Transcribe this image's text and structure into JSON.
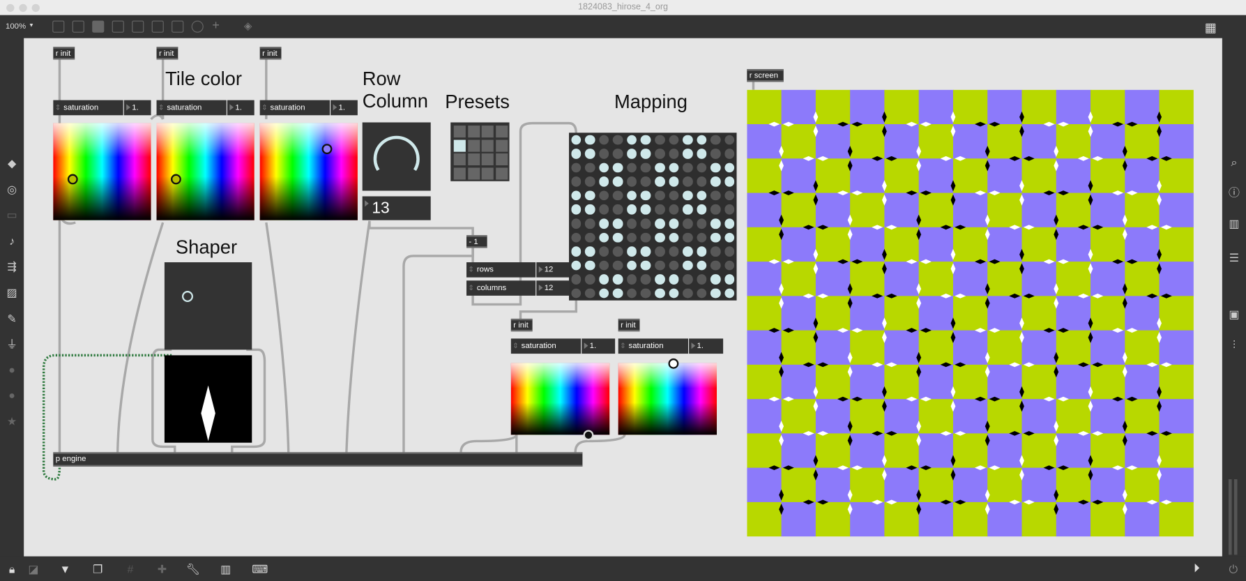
{
  "window": {
    "title": "1824083_hirose_4_org",
    "zoom": "100%"
  },
  "patch": {
    "r_init": "r init",
    "r_screen": "r screen",
    "p_engine": "p engine",
    "minus_one": "- 1",
    "headings": {
      "tile_color": "Tile color",
      "row": "Row",
      "column": "Column",
      "presets": "Presets",
      "mapping": "Mapping",
      "shaper": "Shaper"
    },
    "tile_color_menus": [
      {
        "label": "saturation",
        "value": "1."
      },
      {
        "label": "saturation",
        "value": "1."
      },
      {
        "label": "saturation",
        "value": "1."
      }
    ],
    "lower_menus": [
      {
        "label": "saturation",
        "value": "1."
      },
      {
        "label": "saturation",
        "value": "1."
      }
    ],
    "dial_value": "13",
    "rows": {
      "label": "rows",
      "value": "12"
    },
    "columns": {
      "label": "columns",
      "value": "12"
    },
    "presets": {
      "rows": 4,
      "cols": 4,
      "selected": [
        1,
        0
      ]
    },
    "mapping": [
      [
        1,
        1,
        0,
        0,
        1,
        1,
        0,
        0,
        1,
        1,
        0,
        0
      ],
      [
        1,
        1,
        0,
        0,
        1,
        1,
        0,
        0,
        1,
        1,
        0,
        0
      ],
      [
        0,
        0,
        1,
        1,
        0,
        0,
        1,
        1,
        0,
        0,
        1,
        1
      ],
      [
        0,
        0,
        1,
        1,
        0,
        0,
        1,
        1,
        0,
        0,
        1,
        1
      ],
      [
        1,
        1,
        0,
        0,
        1,
        1,
        0,
        0,
        1,
        1,
        0,
        0
      ],
      [
        1,
        1,
        0,
        0,
        1,
        1,
        0,
        0,
        1,
        1,
        0,
        0
      ],
      [
        0,
        0,
        1,
        1,
        0,
        0,
        1,
        1,
        0,
        0,
        1,
        1
      ],
      [
        0,
        0,
        1,
        1,
        0,
        0,
        1,
        1,
        0,
        0,
        1,
        1
      ],
      [
        1,
        1,
        0,
        0,
        1,
        1,
        0,
        0,
        1,
        1,
        0,
        0
      ],
      [
        1,
        1,
        0,
        0,
        1,
        1,
        0,
        0,
        1,
        1,
        0,
        0
      ],
      [
        0,
        0,
        1,
        1,
        0,
        0,
        1,
        1,
        0,
        0,
        1,
        1
      ],
      [
        0,
        0,
        1,
        1,
        0,
        0,
        1,
        1,
        0,
        0,
        1,
        1
      ]
    ],
    "screen": {
      "grid": 13,
      "color_a": "#b8d800",
      "color_b": "#8c7afa"
    }
  }
}
